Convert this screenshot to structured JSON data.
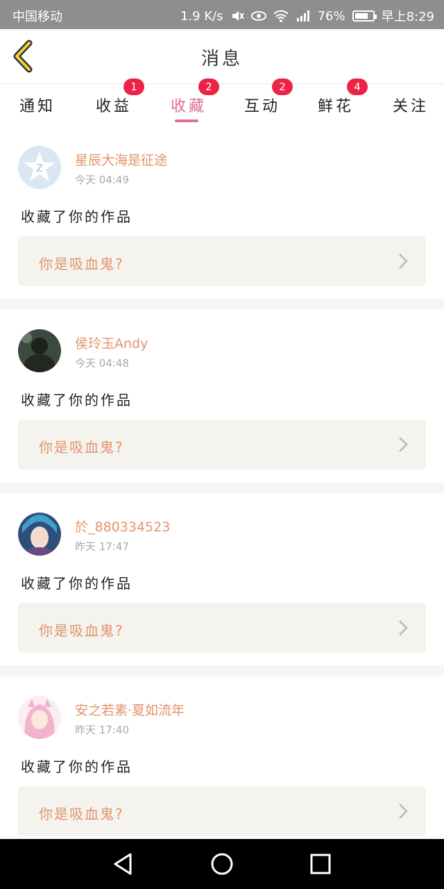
{
  "status_bar": {
    "carrier": "中国移动",
    "net_speed": "1.9 K/s",
    "battery": "76%",
    "battery_level": 0.76,
    "time": "早上8:29"
  },
  "header": {
    "title": "消息"
  },
  "tabs": [
    {
      "label": "通知",
      "badge": ""
    },
    {
      "label": "收益",
      "badge": "1"
    },
    {
      "label": "收藏",
      "badge": "2",
      "active": true
    },
    {
      "label": "互动",
      "badge": "2"
    },
    {
      "label": "鲜花",
      "badge": "4"
    },
    {
      "label": "关注",
      "badge": ""
    }
  ],
  "colors": {
    "accent": "#e06d93",
    "name": "#e3946b",
    "badge": "#ee2244"
  },
  "items": [
    {
      "user": "星辰大海是征途",
      "time": "今天 04:49",
      "action": "收藏了你的作品",
      "work": "你是吸血鬼?"
    },
    {
      "user": "侯玲玉Andy",
      "time": "今天 04:48",
      "action": "收藏了你的作品",
      "work": "你是吸血鬼?"
    },
    {
      "user": "於_880334523",
      "time": "昨天 17:47",
      "action": "收藏了你的作品",
      "work": "你是吸血鬼?"
    },
    {
      "user": "安之若素·夏如流年",
      "time": "昨天 17:40",
      "action": "收藏了你的作品",
      "work": "你是吸血鬼?"
    }
  ]
}
